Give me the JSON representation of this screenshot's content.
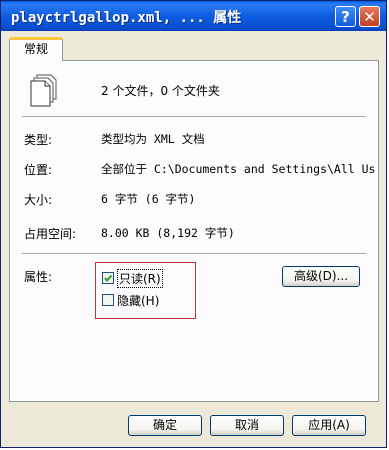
{
  "window": {
    "title": "playctrlgallop.xml, ... 属性",
    "help_glyph": "?",
    "close_glyph": "✕"
  },
  "tabs": [
    {
      "label": "常规"
    }
  ],
  "summary": {
    "icon": "multiple-files-icon",
    "text": "2 个文件，0 个文件夹"
  },
  "fields": {
    "type": {
      "label": "类型:",
      "value": "类型均为 XML 文档"
    },
    "location": {
      "label": "位置:",
      "value": "全部位于 C:\\Documents and Settings\\All Us"
    },
    "size": {
      "label": "大小:",
      "value": "6 字节 (6 字节)"
    },
    "size_on_disk": {
      "label": "占用空间:",
      "value": "8.00 KB (8,192 字节)"
    }
  },
  "attributes": {
    "label": "属性:",
    "readonly": {
      "label": "只读(R)",
      "checked": true
    },
    "hidden": {
      "label": "隐藏(H)",
      "checked": false
    },
    "advanced_button": "高级(D)..."
  },
  "buttons": {
    "ok": "确定",
    "cancel": "取消",
    "apply": "应用(A)"
  }
}
